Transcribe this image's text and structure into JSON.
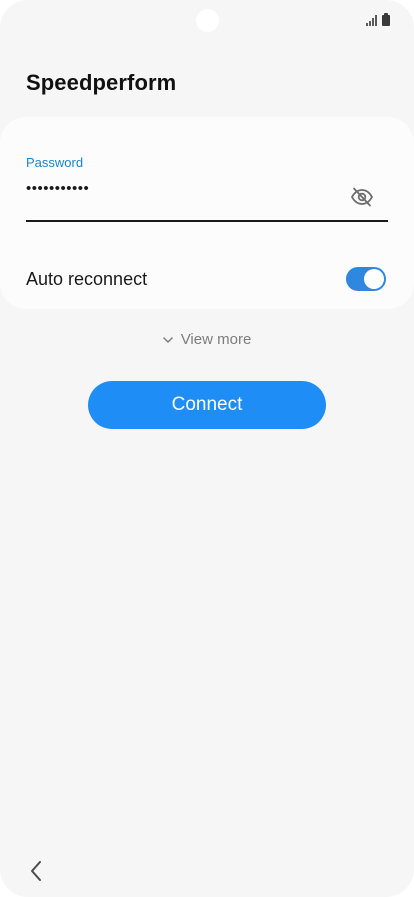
{
  "status_bar": {
    "signal_icon": "signal-strength-icon",
    "battery_icon": "battery-icon"
  },
  "header": {
    "title": "Speedperform"
  },
  "password_field": {
    "label": "Password",
    "value": "•••••••••••",
    "toggle_icon": "eye-off-icon"
  },
  "auto_reconnect": {
    "label": "Auto reconnect",
    "enabled": true
  },
  "view_more": {
    "label": "View more",
    "icon": "chevron-down-icon"
  },
  "connect": {
    "label": "Connect"
  },
  "navigation": {
    "back_icon": "back-chevron-icon"
  },
  "colors": {
    "accent": "#1e8ef6",
    "label_blue": "#1b84c6",
    "background": "#f6f6f6",
    "card": "#fcfcfc"
  }
}
